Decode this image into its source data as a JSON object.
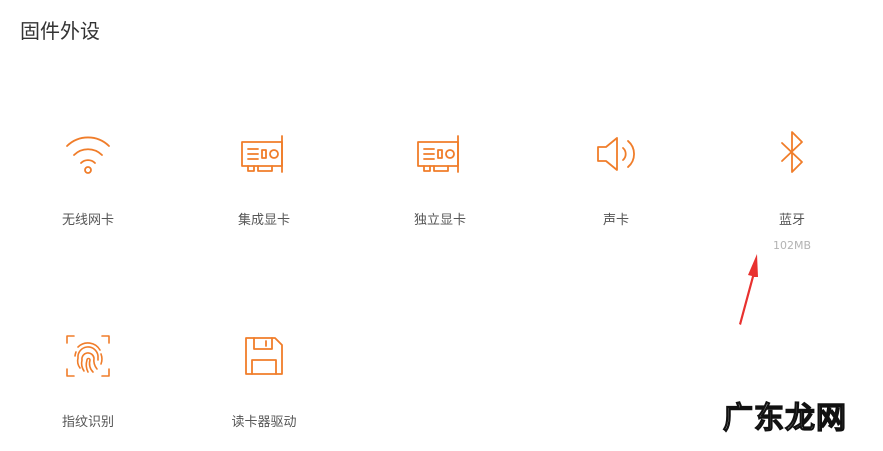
{
  "page": {
    "title": "固件外设"
  },
  "devices": [
    {
      "label": "无线网卡",
      "icon": "wifi-icon"
    },
    {
      "label": "集成显卡",
      "icon": "graphics-card-icon"
    },
    {
      "label": "独立显卡",
      "icon": "graphics-card-icon"
    },
    {
      "label": "声卡",
      "icon": "speaker-icon"
    },
    {
      "label": "蓝牙",
      "icon": "bluetooth-icon",
      "size": "102MB"
    },
    {
      "label": "指纹识别",
      "icon": "fingerprint-icon"
    },
    {
      "label": "读卡器驱动",
      "icon": "save-disk-icon"
    }
  ],
  "annotation": {
    "arrow_color": "#e8312f"
  },
  "watermark": {
    "text": "广东龙网"
  },
  "colors": {
    "accent": "#f07d2a",
    "label": "#555555",
    "sub": "#b3b3b3"
  }
}
